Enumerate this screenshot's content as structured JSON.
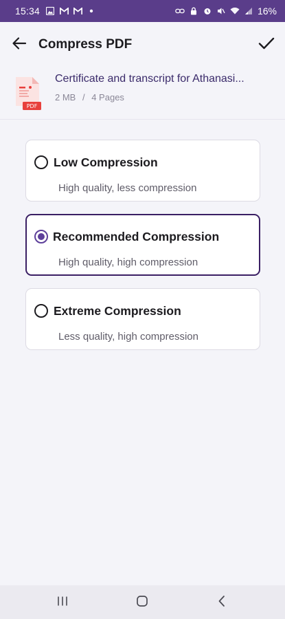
{
  "status_bar": {
    "time": "15:34",
    "battery": "16%",
    "left_icons": [
      "gallery-icon",
      "gmail-icon",
      "gmail-icon",
      "dot-icon"
    ],
    "right_icons": [
      "link-icon",
      "lock-icon",
      "alarm-icon",
      "mute-icon",
      "wifi-icon",
      "signal-icon"
    ]
  },
  "app_bar": {
    "title": "Compress PDF",
    "back_icon": "arrow-left-icon",
    "confirm_icon": "check-icon"
  },
  "file": {
    "name": "Certificate and transcript for Athanasi...",
    "size": "2 MB",
    "separator": "/",
    "pages": "4 Pages",
    "icon_badge": "PDF"
  },
  "options": [
    {
      "title": "Low Compression",
      "description": "High quality, less compression",
      "selected": false
    },
    {
      "title": "Recommended Compression",
      "description": "High quality, high compression",
      "selected": true
    },
    {
      "title": "Extreme Compression",
      "description": "Less quality, high compression",
      "selected": false
    }
  ],
  "nav_bar": {
    "icons": [
      "recents-icon",
      "home-icon",
      "back-icon"
    ]
  },
  "colors": {
    "status_bar": "#5a3d8a",
    "accent": "#5d3f9a",
    "selected_border": "#3a1f64",
    "pdf_red": "#e8403c",
    "background": "#f4f4f9"
  }
}
